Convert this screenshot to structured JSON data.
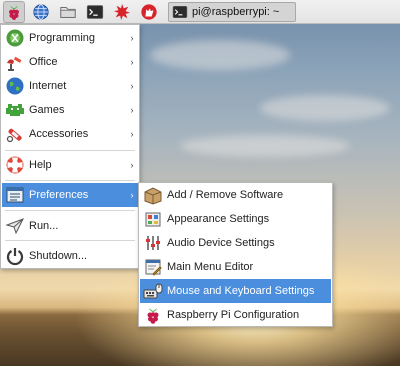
{
  "taskbar": {
    "launchers": [
      {
        "name": "menu",
        "icon": "raspberry-icon"
      },
      {
        "name": "web-browser",
        "icon": "globe-icon"
      },
      {
        "name": "file-manager",
        "icon": "folder-icon"
      },
      {
        "name": "terminal",
        "icon": "terminal-icon"
      },
      {
        "name": "math-kernel",
        "icon": "starburst-icon"
      },
      {
        "name": "wolfram",
        "icon": "wolf-icon"
      }
    ],
    "task_label": "pi@raspberrypi: ~"
  },
  "main_menu": {
    "items": [
      {
        "label": "Programming",
        "icon": "programming-icon",
        "submenu": true
      },
      {
        "label": "Office",
        "icon": "office-icon",
        "submenu": true
      },
      {
        "label": "Internet",
        "icon": "internet-icon",
        "submenu": true
      },
      {
        "label": "Games",
        "icon": "games-icon",
        "submenu": true
      },
      {
        "label": "Accessories",
        "icon": "accessories-icon",
        "submenu": true
      },
      {
        "label": "Help",
        "icon": "help-icon",
        "submenu": true
      },
      {
        "label": "Preferences",
        "icon": "preferences-icon",
        "submenu": true,
        "selected": true
      },
      {
        "label": "Run...",
        "icon": "run-icon",
        "submenu": false
      },
      {
        "label": "Shutdown...",
        "icon": "shutdown-icon",
        "submenu": false
      }
    ]
  },
  "preferences_menu": {
    "items": [
      {
        "label": "Add / Remove Software",
        "icon": "package-icon"
      },
      {
        "label": "Appearance Settings",
        "icon": "appearance-icon"
      },
      {
        "label": "Audio Device Settings",
        "icon": "audio-mixer-icon"
      },
      {
        "label": "Main Menu Editor",
        "icon": "menu-editor-icon"
      },
      {
        "label": "Mouse and Keyboard Settings",
        "icon": "keyboard-mouse-icon",
        "selected": true
      },
      {
        "label": "Raspberry Pi Configuration",
        "icon": "raspberry-icon"
      }
    ]
  },
  "colors": {
    "selection": "#4b8ede",
    "menu_bg": "#ffffff",
    "taskbar_bg": "#ececec"
  },
  "arrow_glyph": "›"
}
